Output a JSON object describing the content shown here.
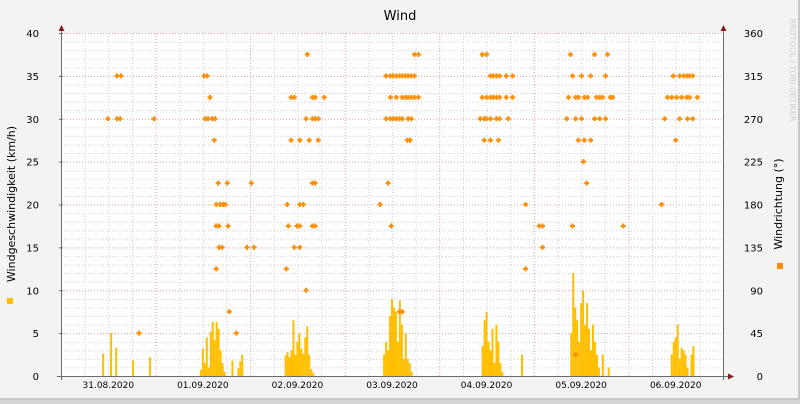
{
  "chart_data": {
    "type": "scatter+bar",
    "title": "Wind",
    "ylabel": "Windgeschwindigkeit (km/h)",
    "y2label": "Windrichtung (°)",
    "watermark": "RRDTOOL / TOBI OETIKER",
    "ylim": [
      0,
      40
    ],
    "y2lim": [
      0,
      360
    ],
    "yticks": [
      "0",
      "5",
      "10",
      "15",
      "20",
      "25",
      "30",
      "35",
      "40"
    ],
    "y2ticks": [
      "0",
      "45",
      "90",
      "135",
      "180",
      "225",
      "270",
      "315",
      "360"
    ],
    "xlim_hours": [
      0,
      168
    ],
    "xticks": [
      "31.08.2020",
      "01.09.2020",
      "02.09.2020",
      "03.09.2020",
      "04.09.2020",
      "05.09.2020",
      "06.09.2020"
    ],
    "grid": true,
    "colors": {
      "speed": "#ffbf00",
      "direction": "#ff8c00",
      "axis": "#6b6b6b",
      "arrow": "#8b1a1a",
      "major_grid": "#e8a0a0",
      "minor_grid": "#cfcfcf"
    },
    "series": [
      {
        "name": "Windgeschwindigkeit",
        "type": "bar",
        "unit": "km/h",
        "axis": "left",
        "values": [
          [
            10.7,
            2.6
          ],
          [
            12.7,
            5
          ],
          [
            14,
            3.3
          ],
          [
            18.3,
            1.8
          ],
          [
            22.6,
            2.2
          ],
          [
            35.5,
            0.7
          ],
          [
            36,
            3.2
          ],
          [
            36.5,
            1.5
          ],
          [
            37,
            4.5
          ],
          [
            37.5,
            1
          ],
          [
            38,
            5.2
          ],
          [
            38.5,
            6.3
          ],
          [
            39,
            4.2
          ],
          [
            39.5,
            6.3
          ],
          [
            40,
            5.5
          ],
          [
            40.5,
            3
          ],
          [
            41,
            1.5
          ],
          [
            41.5,
            0.5
          ],
          [
            43.5,
            1.8
          ],
          [
            45,
            0.9
          ],
          [
            45.5,
            1.7
          ],
          [
            46,
            2.5
          ],
          [
            57,
            2.4
          ],
          [
            57.5,
            2.8
          ],
          [
            58,
            2.2
          ],
          [
            58.5,
            3
          ],
          [
            59,
            6.5
          ],
          [
            59.5,
            2.5
          ],
          [
            60,
            4
          ],
          [
            60.5,
            5
          ],
          [
            61,
            3.2
          ],
          [
            61.5,
            2.6
          ],
          [
            62,
            4.5
          ],
          [
            62.5,
            5.8
          ],
          [
            63,
            2.5
          ],
          [
            63.5,
            0.8
          ],
          [
            64,
            0.4
          ],
          [
            82,
            2.5
          ],
          [
            82.5,
            4
          ],
          [
            83,
            3
          ],
          [
            83.5,
            7
          ],
          [
            84,
            9
          ],
          [
            84.5,
            8
          ],
          [
            85,
            7.5
          ],
          [
            85.5,
            4
          ],
          [
            86,
            8.8
          ],
          [
            86.5,
            6
          ],
          [
            87,
            2
          ],
          [
            87.5,
            5
          ],
          [
            88,
            2
          ],
          [
            88.5,
            1.5
          ],
          [
            89,
            0.5
          ],
          [
            107,
            3.5
          ],
          [
            107.5,
            6.5
          ],
          [
            108,
            7.5
          ],
          [
            108.5,
            4
          ],
          [
            109,
            3
          ],
          [
            109.5,
            5.5
          ],
          [
            110,
            1.5
          ],
          [
            110.5,
            6
          ],
          [
            111,
            4
          ],
          [
            111.5,
            1.5
          ],
          [
            112,
            0.5
          ],
          [
            117,
            2.5
          ],
          [
            129.5,
            5
          ],
          [
            130,
            12
          ],
          [
            130.5,
            8
          ],
          [
            131,
            6.5
          ],
          [
            131.5,
            4
          ],
          [
            132,
            8.5
          ],
          [
            132.5,
            10
          ],
          [
            133,
            6
          ],
          [
            133.5,
            8.5
          ],
          [
            134,
            5.5
          ],
          [
            134.5,
            3
          ],
          [
            135,
            6
          ],
          [
            135.5,
            4
          ],
          [
            136,
            2.5
          ],
          [
            136.5,
            1
          ],
          [
            137.5,
            2.5
          ],
          [
            139,
            1
          ],
          [
            155,
            2.5
          ],
          [
            155.5,
            4
          ],
          [
            156,
            4.5
          ],
          [
            156.5,
            6
          ],
          [
            157,
            2
          ],
          [
            157.5,
            3.3
          ],
          [
            158,
            3
          ],
          [
            158.5,
            2.5
          ],
          [
            159,
            1
          ],
          [
            160,
            2.5
          ],
          [
            160.5,
            3.5
          ]
        ]
      },
      {
        "name": "Windrichtung",
        "type": "scatter",
        "unit": "°",
        "axis": "right",
        "values": [
          [
            14.2,
            315
          ],
          [
            15.2,
            315
          ],
          [
            11.9,
            270
          ],
          [
            14.2,
            270
          ],
          [
            15,
            270
          ],
          [
            23.6,
            270
          ],
          [
            19.8,
            45
          ],
          [
            36.3,
            315
          ],
          [
            37.1,
            315
          ],
          [
            37.8,
            292.5
          ],
          [
            36.6,
            270
          ],
          [
            37.3,
            270
          ],
          [
            38.4,
            270
          ],
          [
            39.1,
            270
          ],
          [
            38.9,
            247.5
          ],
          [
            39.9,
            202.5
          ],
          [
            42.2,
            202.5
          ],
          [
            39.4,
            180
          ],
          [
            40.4,
            180
          ],
          [
            41.1,
            180
          ],
          [
            41.7,
            180
          ],
          [
            39.4,
            157.5
          ],
          [
            40.1,
            157.5
          ],
          [
            42.4,
            157.5
          ],
          [
            40.1,
            135
          ],
          [
            40.9,
            135
          ],
          [
            39.4,
            112.5
          ],
          [
            42.7,
            67.5
          ],
          [
            44.5,
            45
          ],
          [
            47.2,
            135
          ],
          [
            49,
            135
          ],
          [
            48.3,
            202.5
          ],
          [
            62.5,
            337.5
          ],
          [
            58.4,
            292.5
          ],
          [
            59.2,
            292.5
          ],
          [
            63.8,
            292.5
          ],
          [
            64.5,
            292.5
          ],
          [
            66.8,
            292.5
          ],
          [
            62.2,
            270
          ],
          [
            63.8,
            270
          ],
          [
            64.5,
            270
          ],
          [
            65.3,
            270
          ],
          [
            58.4,
            247.5
          ],
          [
            60.6,
            247.5
          ],
          [
            63,
            247.5
          ],
          [
            65.3,
            247.5
          ],
          [
            63.8,
            202.5
          ],
          [
            64.5,
            202.5
          ],
          [
            57.4,
            180
          ],
          [
            60.6,
            180
          ],
          [
            61.5,
            180
          ],
          [
            57.7,
            157.5
          ],
          [
            59.9,
            157.5
          ],
          [
            60.6,
            157.5
          ],
          [
            63.8,
            157.5
          ],
          [
            64.5,
            157.5
          ],
          [
            59.2,
            135
          ],
          [
            60.6,
            135
          ],
          [
            57.2,
            112.5
          ],
          [
            62.2,
            90
          ],
          [
            89.7,
            337.5
          ],
          [
            90.7,
            337.5
          ],
          [
            82.5,
            315
          ],
          [
            83.6,
            315
          ],
          [
            84.3,
            315
          ],
          [
            85.1,
            315
          ],
          [
            85.9,
            315
          ],
          [
            86.6,
            315
          ],
          [
            87.4,
            315
          ],
          [
            88.1,
            315
          ],
          [
            88.9,
            315
          ],
          [
            89.7,
            315
          ],
          [
            83.6,
            292.5
          ],
          [
            85.1,
            292.5
          ],
          [
            86.6,
            292.5
          ],
          [
            87.4,
            292.5
          ],
          [
            88.1,
            292.5
          ],
          [
            88.9,
            292.5
          ],
          [
            89.7,
            292.5
          ],
          [
            90.7,
            292.5
          ],
          [
            82.5,
            270
          ],
          [
            83.6,
            270
          ],
          [
            84.3,
            270
          ],
          [
            85.1,
            270
          ],
          [
            85.9,
            270
          ],
          [
            86.6,
            270
          ],
          [
            88.1,
            270
          ],
          [
            88.9,
            270
          ],
          [
            87.9,
            247.5
          ],
          [
            88.6,
            247.5
          ],
          [
            83,
            202.5
          ],
          [
            81,
            180
          ],
          [
            83.8,
            157.5
          ],
          [
            85.9,
            67.5
          ],
          [
            86.6,
            67.5
          ],
          [
            106.9,
            337.5
          ],
          [
            108,
            337.5
          ],
          [
            109,
            315
          ],
          [
            109.7,
            315
          ],
          [
            110.5,
            315
          ],
          [
            111.3,
            315
          ],
          [
            113,
            315
          ],
          [
            114.6,
            315
          ],
          [
            106.9,
            292.5
          ],
          [
            108,
            292.5
          ],
          [
            109,
            292.5
          ],
          [
            109.7,
            292.5
          ],
          [
            110.5,
            292.5
          ],
          [
            111.3,
            292.5
          ],
          [
            113,
            292.5
          ],
          [
            114.6,
            292.5
          ],
          [
            106.4,
            270
          ],
          [
            107.4,
            270
          ],
          [
            108,
            270
          ],
          [
            109,
            270
          ],
          [
            110.5,
            270
          ],
          [
            111.3,
            270
          ],
          [
            113.5,
            270
          ],
          [
            107.4,
            247.5
          ],
          [
            109,
            247.5
          ],
          [
            111,
            247.5
          ],
          [
            117.9,
            180
          ],
          [
            121.4,
            157.5
          ],
          [
            122.2,
            157.5
          ],
          [
            122.2,
            135
          ],
          [
            117.9,
            112.5
          ],
          [
            129.3,
            337.5
          ],
          [
            135.4,
            337.5
          ],
          [
            138.7,
            337.5
          ],
          [
            129.8,
            315
          ],
          [
            132.1,
            315
          ],
          [
            134.4,
            315
          ],
          [
            138.2,
            315
          ],
          [
            128.8,
            292.5
          ],
          [
            130.6,
            292.5
          ],
          [
            131.3,
            292.5
          ],
          [
            132.8,
            292.5
          ],
          [
            133.6,
            292.5
          ],
          [
            135.9,
            292.5
          ],
          [
            136.7,
            292.5
          ],
          [
            137.4,
            292.5
          ],
          [
            139.4,
            292.5
          ],
          [
            140,
            292.5
          ],
          [
            128.3,
            270
          ],
          [
            130.6,
            270
          ],
          [
            132.1,
            270
          ],
          [
            135.4,
            270
          ],
          [
            136.7,
            270
          ],
          [
            138.2,
            270
          ],
          [
            131.3,
            247.5
          ],
          [
            132.8,
            247.5
          ],
          [
            134.4,
            247.5
          ],
          [
            132.6,
            225
          ],
          [
            133.4,
            202.5
          ],
          [
            129.8,
            157.5
          ],
          [
            142.7,
            157.5
          ],
          [
            130.6,
            22.5
          ],
          [
            155.4,
            315
          ],
          [
            157,
            315
          ],
          [
            158,
            315
          ],
          [
            158.8,
            315
          ],
          [
            159.5,
            315
          ],
          [
            160.3,
            315
          ],
          [
            153.9,
            292.5
          ],
          [
            155,
            292.5
          ],
          [
            156.2,
            292.5
          ],
          [
            157.5,
            292.5
          ],
          [
            158.8,
            292.5
          ],
          [
            159.5,
            292.5
          ],
          [
            161.5,
            292.5
          ],
          [
            153.2,
            270
          ],
          [
            157,
            270
          ],
          [
            159,
            270
          ],
          [
            160.3,
            270
          ],
          [
            156,
            247.5
          ],
          [
            152.4,
            180
          ]
        ]
      }
    ]
  }
}
